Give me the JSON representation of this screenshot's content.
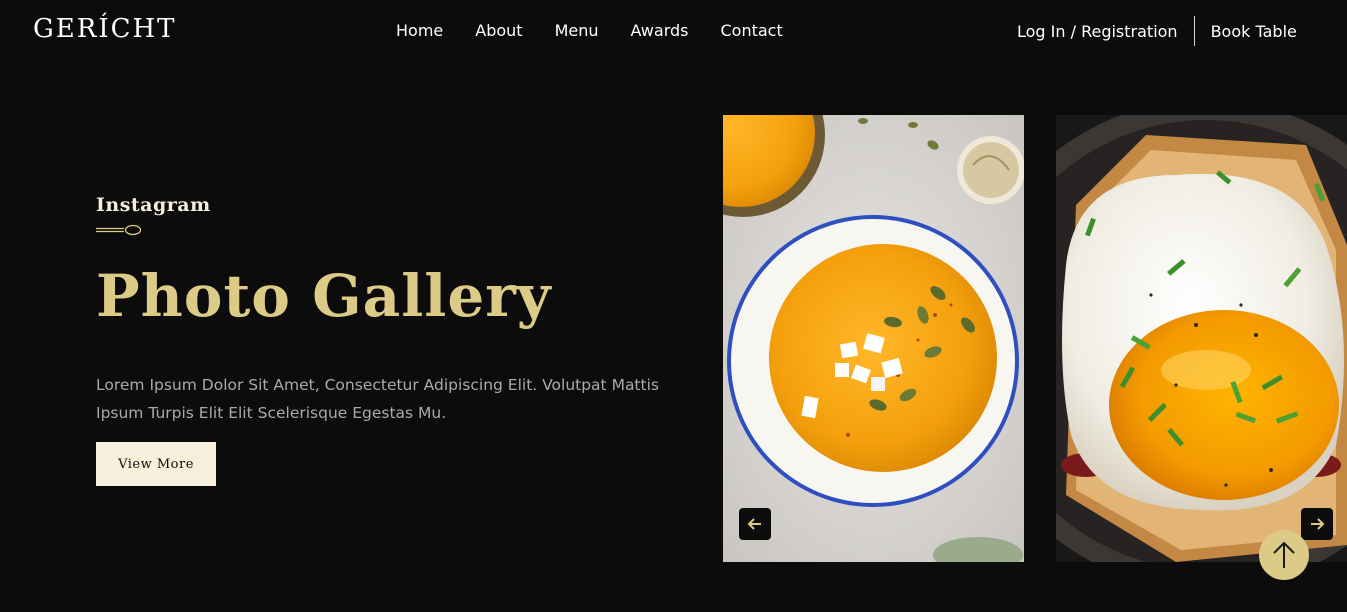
{
  "brand": {
    "logo": "GERÍCHT"
  },
  "nav": {
    "links": [
      "Home",
      "About",
      "Menu",
      "Awards",
      "Contact"
    ],
    "login": "Log In / Registration",
    "book": "Book Table"
  },
  "gallery": {
    "subtitle": "Instagram",
    "title": "Photo Gallery",
    "description": "Lorem Ipsum Dolor Sit Amet, Consectetur Adipiscing Elit. Volutpat Mattis Ipsum Turpis Elit Elit Scelerisque Egestas Mu.",
    "button": "View More",
    "images": [
      "pumpkin-soup-photo",
      "fried-egg-toast-photo"
    ]
  },
  "controls": {
    "prev_icon": "arrow-left-icon",
    "next_icon": "arrow-right-icon",
    "scroll_top_icon": "arrow-up-icon"
  },
  "colors": {
    "background": "#0c0c0c",
    "golden": "#dcca87",
    "crimson": "#f5efdb",
    "grey_text": "#aaaaaa"
  }
}
